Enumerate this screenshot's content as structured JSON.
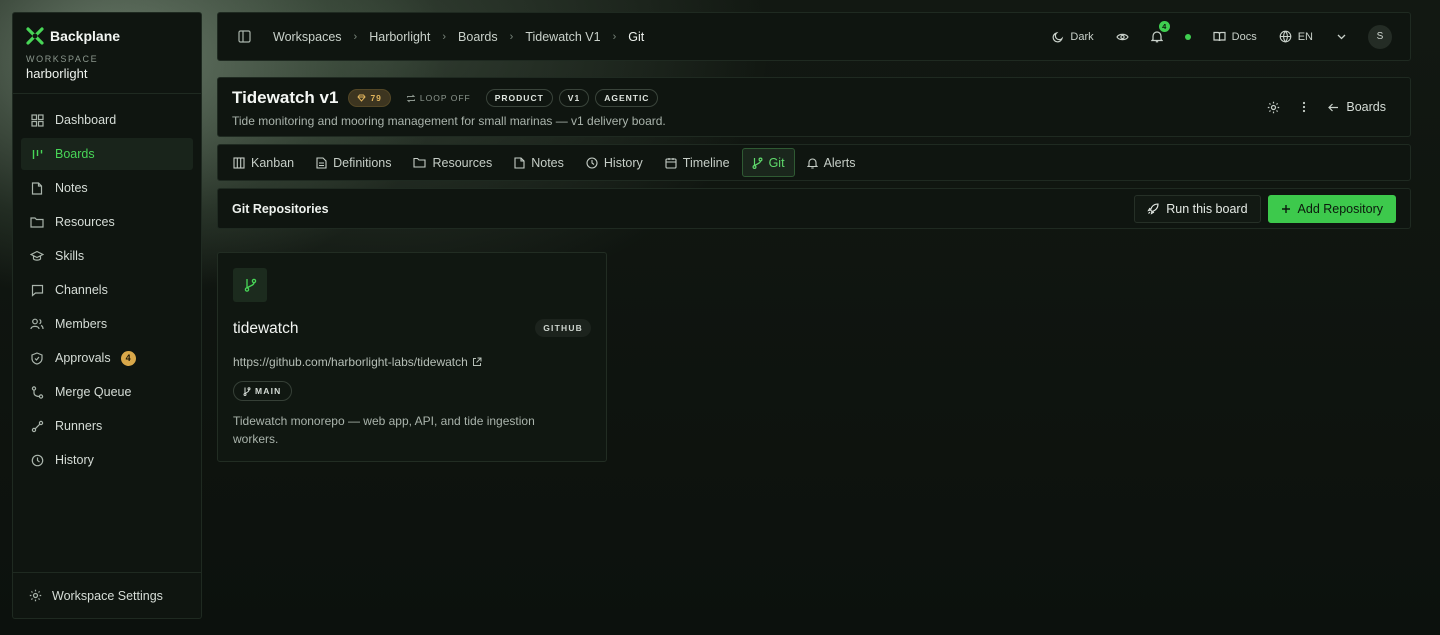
{
  "sidebar": {
    "brand": "Backplane",
    "workspace_label": "WORKSPACE",
    "workspace_name": "harborlight",
    "items": [
      {
        "label": "Dashboard",
        "icon": "grid-icon"
      },
      {
        "label": "Boards",
        "icon": "boards-icon",
        "active": true
      },
      {
        "label": "Notes",
        "icon": "note-icon"
      },
      {
        "label": "Resources",
        "icon": "folder-icon"
      },
      {
        "label": "Skills",
        "icon": "graduation-cap-icon"
      },
      {
        "label": "Channels",
        "icon": "chat-icon"
      },
      {
        "label": "Members",
        "icon": "users-icon"
      },
      {
        "label": "Approvals",
        "icon": "shield-icon",
        "badge": "4"
      },
      {
        "label": "Merge Queue",
        "icon": "merge-icon"
      },
      {
        "label": "Runners",
        "icon": "runner-icon"
      },
      {
        "label": "History",
        "icon": "history-icon"
      }
    ],
    "footer": "Workspace Settings"
  },
  "topbar": {
    "breadcrumbs": [
      "Workspaces",
      "Harborlight",
      "Boards",
      "Tidewatch V1",
      "Git"
    ],
    "theme": "Dark",
    "notifications": "4",
    "docs": "Docs",
    "language": "EN",
    "avatar": "S"
  },
  "board": {
    "title": "Tidewatch v1",
    "score": "79",
    "loop": "LOOP OFF",
    "tags": [
      "PRODUCT",
      "V1",
      "AGENTIC"
    ],
    "description": "Tide monitoring and mooring management for small marinas — v1 delivery board.",
    "back_label": "Boards"
  },
  "tabs": [
    {
      "label": "Kanban",
      "icon": "kanban-icon"
    },
    {
      "label": "Definitions",
      "icon": "document-icon"
    },
    {
      "label": "Resources",
      "icon": "folder-icon"
    },
    {
      "label": "Notes",
      "icon": "note-icon"
    },
    {
      "label": "History",
      "icon": "clock-icon"
    },
    {
      "label": "Timeline",
      "icon": "timeline-icon"
    },
    {
      "label": "Git",
      "icon": "git-branch-icon",
      "active": true
    },
    {
      "label": "Alerts",
      "icon": "bell-icon"
    }
  ],
  "section": {
    "title": "Git Repositories",
    "run_label": "Run this board",
    "add_label": "Add Repository"
  },
  "repo": {
    "name": "tidewatch",
    "provider": "GITHUB",
    "url": "https://github.com/harborlight-labs/tidewatch",
    "branch": "MAIN",
    "description": "Tidewatch monorepo — web app, API, and tide ingestion workers."
  },
  "colors": {
    "accent": "#3dc94c",
    "badge": "#d9a84a",
    "background": "#0b100c"
  }
}
